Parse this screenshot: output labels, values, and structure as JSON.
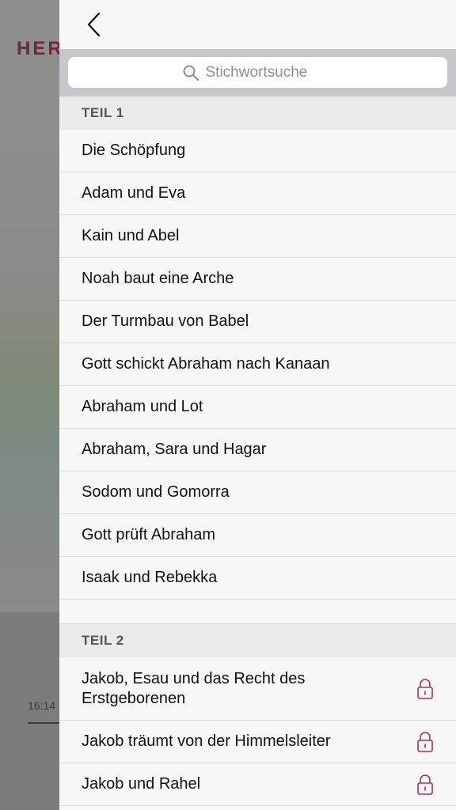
{
  "background": {
    "title": "HER",
    "time": "16:14"
  },
  "drawer": {
    "back_icon": "chevron-left-icon",
    "search": {
      "placeholder": "Stichwortsuche",
      "value": ""
    },
    "sections": [
      {
        "title": "TEIL 1",
        "items": [
          "Die Schöpfung",
          "Adam und Eva",
          "Kain und Abel",
          "Noah baut eine Arche",
          "Der Turmbau von Babel",
          "Gott schickt Abraham nach Kanaan",
          "Abraham und Lot",
          "Abraham, Sara und Hagar",
          "Sodom und Gomorra",
          "Gott prüft Abraham",
          "Isaak und Rebekka"
        ]
      },
      {
        "title": "TEIL 2",
        "items": [
          "Jakob, Esau und das Recht des Erstgeborenen",
          "Jakob träumt von der Himmelsleiter",
          "Jakob und Rahel"
        ],
        "locked_icon": "lock-icon"
      }
    ],
    "colors": {
      "accent": "#b0305a",
      "section_bg": "#eaeaea",
      "search_bar_bg": "#c6c6cb"
    }
  }
}
